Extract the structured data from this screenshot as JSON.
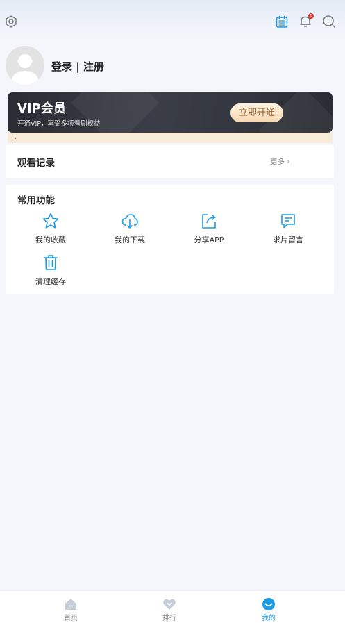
{
  "header": {
    "icons": [
      "settings-icon",
      "checkin-calendar-icon",
      "bell-icon",
      "search-icon"
    ],
    "notification_badge": "1",
    "accent_color": "#1a9be6"
  },
  "profile": {
    "login_text": "登录 | 注册"
  },
  "vip": {
    "title": "VIP会员",
    "subtitle": "开通VIP，享受多项看剧权益",
    "button_label": "立即开通",
    "strip_chevron": "›"
  },
  "history": {
    "title": "观看记录",
    "more_label": "更多 ›"
  },
  "functions": {
    "title": "常用功能",
    "items": [
      {
        "label": "我的收藏",
        "icon": "star-icon"
      },
      {
        "label": "我的下载",
        "icon": "cloud-download-icon"
      },
      {
        "label": "分享APP",
        "icon": "share-icon"
      },
      {
        "label": "求片留言",
        "icon": "message-icon"
      },
      {
        "label": "清理缓存",
        "icon": "trash-icon"
      }
    ]
  },
  "tabbar": {
    "items": [
      {
        "label": "首页",
        "icon": "home-icon",
        "active": false
      },
      {
        "label": "排行",
        "icon": "ranking-icon",
        "active": false
      },
      {
        "label": "我的",
        "icon": "profile-smile-icon",
        "active": true
      }
    ]
  }
}
